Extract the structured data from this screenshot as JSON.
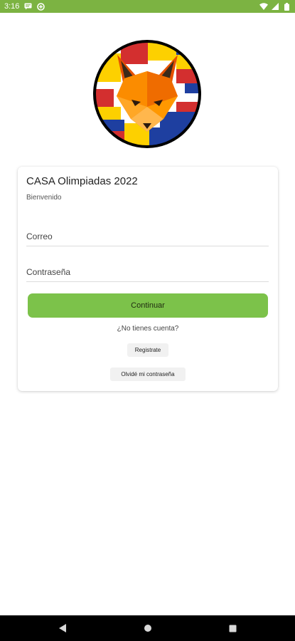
{
  "status_bar": {
    "time": "3:16",
    "left_icons": [
      "message-icon",
      "data-saver-icon"
    ],
    "right_icons": [
      "wifi-icon",
      "signal-icon",
      "battery-icon"
    ],
    "background": "#7cb342"
  },
  "logo": {
    "icon": "fox-logo-icon"
  },
  "card": {
    "title": "CASA Olimpiadas 2022",
    "subtitle": "Bienvenido",
    "email": {
      "placeholder": "Correo",
      "value": ""
    },
    "password": {
      "placeholder": "Contraseña",
      "value": ""
    },
    "continue_label": "Continuar",
    "no_account_text": "¿No tienes cuenta?",
    "register_label": "Registrate",
    "forgot_label": "Olvidé mi contraseña",
    "accent": "#7cc24a"
  },
  "nav_bar": {
    "buttons": [
      "back-icon",
      "home-icon",
      "recents-icon"
    ]
  }
}
